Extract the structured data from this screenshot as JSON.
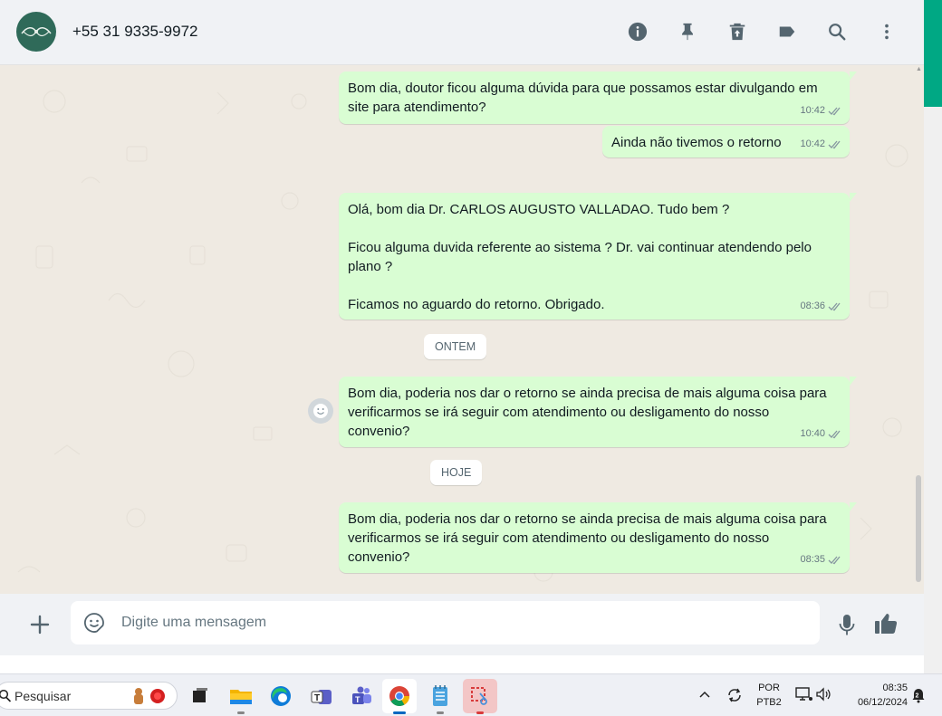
{
  "header": {
    "contact_name": "+55 31 9335-9972",
    "icons": [
      "info-icon",
      "pin-icon",
      "delete-icon",
      "label-icon",
      "search-icon",
      "menu-icon"
    ]
  },
  "messages": [
    {
      "text": "Bom dia, doutor ficou alguma dúvida para que possamos estar divulgando em\nsite para atendimento?",
      "time": "10:42",
      "status": "read"
    },
    {
      "text": "Ainda não tivemos o retorno",
      "time": "10:42",
      "status": "read"
    },
    {
      "text": "Olá, bom dia Dr. CARLOS AUGUSTO VALLADAO. Tudo bem ?\n\nFicou alguma duvida referente ao sistema ? Dr. vai continuar atendendo pelo\nplano ?\n\nFicamos no aguardo do retorno. Obrigado.",
      "time": "08:36",
      "status": "read"
    },
    {
      "text": "Bom dia, poderia nos dar o retorno se ainda precisa de mais alguma coisa para\nverificarmos se irá seguir com atendimento ou desligamento do nosso\nconvenio?",
      "time": "10:40",
      "status": "read"
    },
    {
      "text": "Bom dia, poderia nos dar o retorno se ainda precisa de mais alguma coisa para\nverificarmos se irá seguir com atendimento ou desligamento do nosso\nconvenio?",
      "time": "08:35",
      "status": "read"
    }
  ],
  "date_chips": {
    "yesterday": "ONTEM",
    "today": "HOJE"
  },
  "composer": {
    "placeholder": "Digite uma mensagem"
  },
  "taskbar": {
    "search_label": "Pesquisar",
    "language_top": "POR",
    "language_bottom": "PTB2",
    "time": "08:35",
    "date": "06/12/2024"
  },
  "colors": {
    "bubble_out": "#d9fdd3",
    "accent": "#00a884",
    "read_ticks": "#667781"
  }
}
